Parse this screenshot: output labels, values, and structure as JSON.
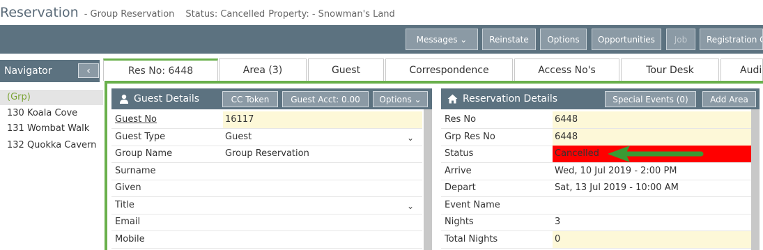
{
  "header": {
    "app_title": "Reservation",
    "subtitle": "- Group Reservation",
    "status_text": "Status: Cancelled",
    "property_text": "Property: - Snowman's Land"
  },
  "toolbar": {
    "messages": "Messages ⌄",
    "reinstate": "Reinstate",
    "options": "Options",
    "opportunities": "Opportunities",
    "job": "Job",
    "registration": "Registration C"
  },
  "navigator": {
    "title": "Navigator",
    "collapse_glyph": "‹",
    "items": [
      {
        "label": "(Grp)"
      },
      {
        "label": "130 Koala Cove"
      },
      {
        "label": "131 Wombat Walk"
      },
      {
        "label": "132 Quokka Cavern"
      }
    ]
  },
  "tabs": [
    {
      "label": "Res No: 6448"
    },
    {
      "label": "Area (3)"
    },
    {
      "label": "Guest"
    },
    {
      "label": "Correspondence"
    },
    {
      "label": "Access No's"
    },
    {
      "label": "Tour Desk"
    },
    {
      "label": "Audi"
    }
  ],
  "guest_details": {
    "title": "Guest Details",
    "cc_token": "CC Token",
    "guest_acct": "Guest Acct: 0.00",
    "options": "Options ⌄",
    "rows": [
      {
        "label": "Guest No",
        "value": "16117"
      },
      {
        "label": "Guest Type",
        "value": "Guest"
      },
      {
        "label": "Group Name",
        "value": "Group Reservation"
      },
      {
        "label": "Surname",
        "value": ""
      },
      {
        "label": "Given",
        "value": ""
      },
      {
        "label": "Title",
        "value": ""
      },
      {
        "label": "Email",
        "value": ""
      },
      {
        "label": "Mobile",
        "value": ""
      }
    ]
  },
  "reservation_details": {
    "title": "Reservation Details",
    "special_events": "Special Events (0)",
    "add_area": "Add Area",
    "rows": [
      {
        "label": "Res No",
        "value": "6448"
      },
      {
        "label": "Grp Res No",
        "value": "6448"
      },
      {
        "label": "Status",
        "value": "Cancelled"
      },
      {
        "label": "Arrive",
        "value": "Wed, 10 Jul 2019 - 2:00 PM"
      },
      {
        "label": "Depart",
        "value": "Sat, 13 Jul 2019 - 10:00 AM"
      },
      {
        "label": "Event Name",
        "value": ""
      },
      {
        "label": "Nights",
        "value": "3"
      },
      {
        "label": "Total Nights",
        "value": "0"
      }
    ]
  },
  "colors": {
    "accent_green": "#6ab04c",
    "header_slate": "#5c7280",
    "status_red": "#ff0000",
    "arrow_green": "#3a9a34"
  }
}
